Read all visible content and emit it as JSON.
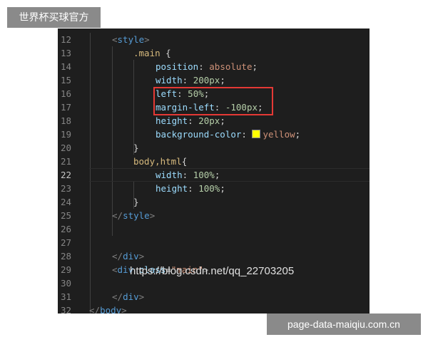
{
  "overlay": {
    "top_badge": "世界杯买球官方",
    "bottom_badge": "page-data-maiqiu.com.cn",
    "watermark": "https://blog.csdn.net/qq_22703205"
  },
  "colors": {
    "editor_bg": "#1e1e1e",
    "highlight_box": "#e53935",
    "swatch": "#ffff00"
  },
  "editor": {
    "active_line": "22",
    "lines": [
      {
        "num": "12",
        "tokens": [
          {
            "t": "<",
            "c": "tg"
          },
          {
            "t": "style",
            "c": "tn"
          },
          {
            "t": ">",
            "c": "tg"
          }
        ]
      },
      {
        "num": "13",
        "tokens": [
          {
            "t": ".main",
            "c": "sel"
          },
          {
            "t": " {",
            "c": "pu"
          }
        ]
      },
      {
        "num": "14",
        "tokens": [
          {
            "t": "position",
            "c": "pr"
          },
          {
            "t": ": ",
            "c": "pu"
          },
          {
            "t": "absolute",
            "c": "vl"
          },
          {
            "t": ";",
            "c": "pu"
          }
        ]
      },
      {
        "num": "15",
        "tokens": [
          {
            "t": "width",
            "c": "pr"
          },
          {
            "t": ": ",
            "c": "pu"
          },
          {
            "t": "200px",
            "c": "nm"
          },
          {
            "t": ";",
            "c": "pu"
          }
        ]
      },
      {
        "num": "16",
        "tokens": [
          {
            "t": "left",
            "c": "pr"
          },
          {
            "t": ": ",
            "c": "pu"
          },
          {
            "t": "50%",
            "c": "nm"
          },
          {
            "t": ";",
            "c": "pu"
          }
        ]
      },
      {
        "num": "17",
        "tokens": [
          {
            "t": "margin-left",
            "c": "pr"
          },
          {
            "t": ": ",
            "c": "pu"
          },
          {
            "t": "-100px",
            "c": "nm"
          },
          {
            "t": ";",
            "c": "pu"
          }
        ]
      },
      {
        "num": "18",
        "tokens": [
          {
            "t": "height",
            "c": "pr"
          },
          {
            "t": ": ",
            "c": "pu"
          },
          {
            "t": "20px",
            "c": "nm"
          },
          {
            "t": ";",
            "c": "pu"
          }
        ]
      },
      {
        "num": "19",
        "tokens": [
          {
            "t": "background-color",
            "c": "pr"
          },
          {
            "t": ": ",
            "c": "pu"
          },
          {
            "t": "",
            "c": "swatch"
          },
          {
            "t": "yellow",
            "c": "vl"
          },
          {
            "t": ";",
            "c": "pu"
          }
        ]
      },
      {
        "num": "20",
        "tokens": [
          {
            "t": "}",
            "c": "pu"
          }
        ]
      },
      {
        "num": "21",
        "tokens": [
          {
            "t": "body,html",
            "c": "sel"
          },
          {
            "t": "{",
            "c": "pu"
          }
        ]
      },
      {
        "num": "22",
        "tokens": [
          {
            "t": "width",
            "c": "pr"
          },
          {
            "t": ": ",
            "c": "pu"
          },
          {
            "t": "100%",
            "c": "nm"
          },
          {
            "t": ";",
            "c": "pu"
          }
        ]
      },
      {
        "num": "23",
        "tokens": [
          {
            "t": "height",
            "c": "pr"
          },
          {
            "t": ": ",
            "c": "pu"
          },
          {
            "t": "100%",
            "c": "nm"
          },
          {
            "t": ";",
            "c": "pu"
          }
        ]
      },
      {
        "num": "24",
        "tokens": [
          {
            "t": "}",
            "c": "pu"
          }
        ]
      },
      {
        "num": "25",
        "tokens": [
          {
            "t": "</",
            "c": "tg"
          },
          {
            "t": "style",
            "c": "tn"
          },
          {
            "t": ">",
            "c": "tg"
          }
        ]
      },
      {
        "num": "26",
        "tokens": []
      },
      {
        "num": "27",
        "tokens": []
      },
      {
        "num": "28",
        "tokens": [
          {
            "t": "</",
            "c": "tg"
          },
          {
            "t": "div",
            "c": "tn"
          },
          {
            "t": ">",
            "c": "tg"
          }
        ]
      },
      {
        "num": "29",
        "tokens": [
          {
            "t": "<",
            "c": "tg"
          },
          {
            "t": "div",
            "c": "tn"
          },
          {
            "t": " ",
            "c": "pu"
          },
          {
            "t": "class",
            "c": "at"
          },
          {
            "t": "=",
            "c": "pu"
          },
          {
            "t": "\"main\"",
            "c": "vl"
          },
          {
            "t": ">",
            "c": "tg"
          }
        ]
      },
      {
        "num": "30",
        "tokens": []
      },
      {
        "num": "31",
        "tokens": [
          {
            "t": "</",
            "c": "tg"
          },
          {
            "t": "div",
            "c": "tn"
          },
          {
            "t": ">",
            "c": "tg"
          }
        ]
      },
      {
        "num": "32",
        "tokens": [
          {
            "t": "</",
            "c": "tg"
          },
          {
            "t": "body",
            "c": "tn"
          },
          {
            "t": ">",
            "c": "tg"
          }
        ]
      }
    ]
  }
}
